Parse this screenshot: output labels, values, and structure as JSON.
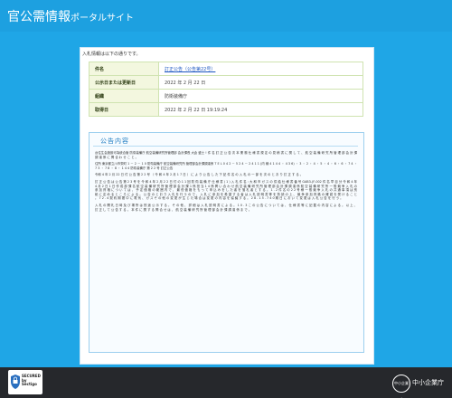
{
  "header": {
    "title": "官公需情報",
    "subtitle": "ポータルサイト"
  },
  "intro_text": "入札情報は以下の通りです。",
  "details": [
    {
      "label": "件名",
      "value": "訂正公告（公告第22号）",
      "is_link": true
    },
    {
      "label": "公示日または更新日",
      "value": "2022 年 2 月 22 日",
      "is_link": false
    },
    {
      "label": "組織",
      "value": "防衛装備庁",
      "is_link": false
    },
    {
      "label": "取得日",
      "value": "2022 年 2 月 22 日 19:19:24",
      "is_link": false
    }
  ],
  "notice": {
    "heading": "公告内容",
    "paragraphs": [
      "台住生会施設可為統合管 防衛装備庁 航空装備研究所管理部 会計課長 大倉 盛士 ! 件 名 訂 正 公 告 次 本 業 務 仕 様 書 規 定 の 見 積 書 に 関 し て 、 航 空 装 備 研 究 所 管 理 部 会 計 課 調 達 係 に 問 合 わ せ こ と 。",
      "住所 東京都立川市栄町 1 － 2 － 1 0 防衛装備庁 航空装備研究所 管理部会計課調達係 T E L 0 4 2 － 5 2 4 － 2 4 1 1 (内 線 4 1 4 4 ・ 4 3 6) ・ 3 ・ 2 ・ 4 ・ 5 ・ 4 ・ 6 ・ 6 ・ 7 4 ・ 7 3 ・ 7 8 ・ 8 ・ 1 4 4 防衛装備庁 第 2 2 号 訂正公告",
      "令和 4 年 2 月 22 日 付 公 告 第 2 2 号 （ 令 和 4 年 2 月 1 7 日 ） に よ り 公 告 し た 下 記 件 名 の 入 札 の 一 部 を 次 の と お り 訂 正 す る 。",
      "訂 正 公 告 は 公 告 第 2 3 号 を 令 和 4 年 2 月 2 2 日 付 の 1 1 回 防 衛 装 備 庁 仕 様 書 ( 1 ) 入 札 件 名 : 大 和 市 ガ ス の 供 給 仕 様 書 番 号 GAB3-JF-002 件 名 早 目 分 令 和 4 年 4 月 2 日 1 日 作 成 部 課 名 航 空 装 備 研 究 所 管 理 部 会 計 課 1 係 担 当 1 4 係 問 い 合 わ せ 航 空 装 備 研 究 所 管 理 部 会 計 課 調 達 係 航 空 装 備 研 究 所 一 般 競 争 入 札 の 参 加 資 格 に つ い て は 、 予 定 価 格 の 範 囲 内 で 、 最 低 価 格 を も っ て 申 込 み を し た 者 を 落 札 者 と す る 。 1 . 2 件 名 の 2 2 号 様 一 般 競 争 入 札 の 共 通 事 項 は 別 紙 に 定 め る と こ ろ に よ る 。 公 告 の と お り 入 札 を 行 う の で 、 入 札 に 参 加 を 希 望 す る 者 は 入 札 説 明 書 等 を 熟 読 の 上 、 競 争 参 加 資 格 の 確 認 を 受 け る こ と 。 7 2 . 4 契 約 期 間 中 に 電 気 、 ガ ス そ の 他 の 変 更 が 生 じ た 場 合 は 変 更 の 内 容 を 協 議 す る 。 2 8 . 1 5 . 7 4 0 期 日 に お い て 変 更 は 入 札 公 告 を 行 う 。",
      "入 札 の 開 札 日 時 及 び 場 所 は 別 途 公 示 す る 。 そ の 他 、 詳 細 は 入 札 説 明 書 に よ る 。 1 0 . 3 こ の 公 告 に つ い て は 、 仕 様 書 等 に 記 載 の 内 容 に よ る 。 以 上 、 訂 正 し て 公 告 す る 。 本 件 に 関 す る 問 合 せ は 、 航 空 装 備 研 究 所 管 理 部 会 計 課 調 達 係 ま で 。"
    ]
  },
  "footer": {
    "secured_label": "SECURED",
    "secured_by": "by Sectigo",
    "brand_badge": "中小企業庁",
    "brand_name": "中小企業庁"
  },
  "colors": {
    "header_blue": "#1da0e0",
    "page_blue": "#1fa6e6",
    "label_green": "#f3f7df",
    "footer_dark": "#26282c"
  }
}
